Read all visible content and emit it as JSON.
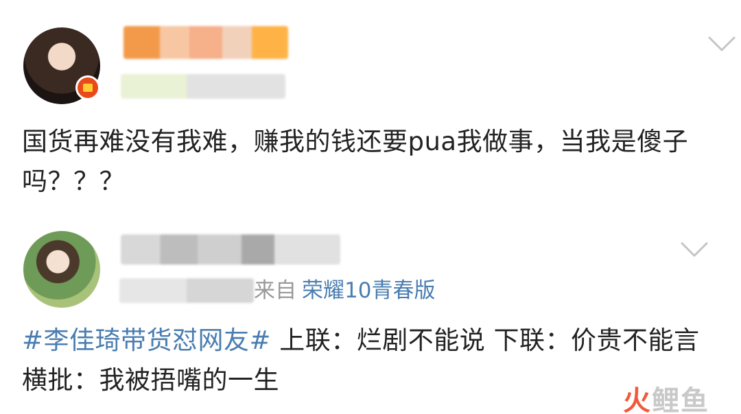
{
  "posts": [
    {
      "content": "国货再难没有我难，赚我的钱还要pua我做事，当我是傻子吗？？？"
    },
    {
      "source_prefix": "来自",
      "source_device": "荣耀10青春版",
      "hashtag": "#李佳琦带货怼网友#",
      "content": "上联：烂剧不能说  下联：价贵不能言  横批：我被捂嘴的一生"
    }
  ],
  "watermark": {
    "part1": "火",
    "part2": "鲤鱼"
  },
  "icons": [
    "chevron-down-icon",
    "avatar",
    "verified-badge-icon"
  ],
  "colors": {
    "link_blue": "#4a7db0",
    "text": "#222222",
    "muted": "#999999",
    "watermark_red": "#f05a3c"
  }
}
